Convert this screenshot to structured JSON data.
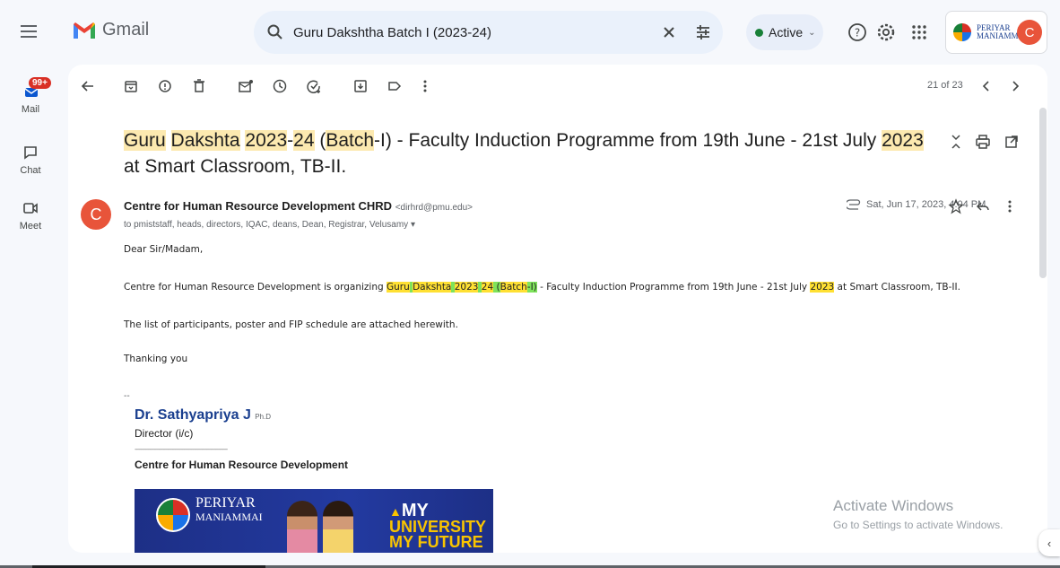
{
  "app": {
    "name": "Gmail"
  },
  "search": {
    "value": "Guru Dakshtha Batch I (2023-24)"
  },
  "status": {
    "label": "Active",
    "color": "#188038"
  },
  "account": {
    "org_line1": "PERIYAR",
    "org_line2": "MANIAMMAI",
    "avatar_letter": "C"
  },
  "rail": {
    "mail": {
      "label": "Mail",
      "badge": "99+"
    },
    "chat": {
      "label": "Chat"
    },
    "meet": {
      "label": "Meet"
    }
  },
  "toolbar": {
    "pager": "21 of 23"
  },
  "message": {
    "subject_parts": [
      {
        "text": "Guru",
        "hl": true
      },
      {
        "text": " ",
        "hl": false
      },
      {
        "text": "Dakshta",
        "hl": true
      },
      {
        "text": " ",
        "hl": false
      },
      {
        "text": "2023",
        "hl": true
      },
      {
        "text": "-",
        "hl": false
      },
      {
        "text": "24",
        "hl": true
      },
      {
        "text": " (",
        "hl": false
      },
      {
        "text": "Batch",
        "hl": true
      },
      {
        "text": "-I) - Faculty Induction Programme from 19th June - 21st July ",
        "hl": false
      },
      {
        "text": "2023",
        "hl": true
      },
      {
        "text": " at Smart Classroom, TB-II.",
        "hl": false
      }
    ],
    "sender_name": "Centre for Human Resource Development CHRD",
    "sender_email": "<dirhrd@pmu.edu>",
    "recipients": "to pmiststaff, heads, directors, IQAC, deans, Dean, Registrar, Velusamy",
    "date": "Sat, Jun 17, 2023, 4:04 PM",
    "sender_avatar_letter": "C",
    "greeting": "Dear Sir/Madam,",
    "para1_pre": "Centre for Human Resource Development is organizing ",
    "para1_hl": [
      {
        "text": "Guru",
        "c": "y"
      },
      {
        "text": " ",
        "c": "g"
      },
      {
        "text": "Dakshta",
        "c": "y"
      },
      {
        "text": " ",
        "c": "g"
      },
      {
        "text": "2023",
        "c": "y"
      },
      {
        "text": " ",
        "c": "g"
      },
      {
        "text": "24",
        "c": "y"
      },
      {
        "text": " (",
        "c": "g"
      },
      {
        "text": "Batch",
        "c": "y"
      },
      {
        "text": "-I)",
        "c": "g"
      }
    ],
    "para1_mid": " - Faculty Induction Programme from 19th June - 21st July ",
    "para1_year": "2023",
    "para1_post": " at Smart Classroom, TB-II.",
    "para2": "The list of participants, poster and FIP schedule are attached herewith.",
    "closing": "Thanking you",
    "sig_dash": "--"
  },
  "signature": {
    "name": "Dr. Sathyapriya J",
    "degree": "Ph.D",
    "title": "Director (i/c)",
    "line": "--------------------------------------------------------------",
    "centre": "Centre for Human Resource Development",
    "banner_name1": "PERIYAR",
    "banner_name2": "MANIAMMAI",
    "banner_tag1": "MY",
    "banner_tag2": "UNIVERSITY",
    "banner_tag3": "MY FUTURE"
  },
  "watermark": {
    "line1": "Activate Windows",
    "line2": "Go to Settings to activate Windows."
  },
  "colors": {
    "highlight": "#fce9b0",
    "brand_red": "#e8543a"
  }
}
